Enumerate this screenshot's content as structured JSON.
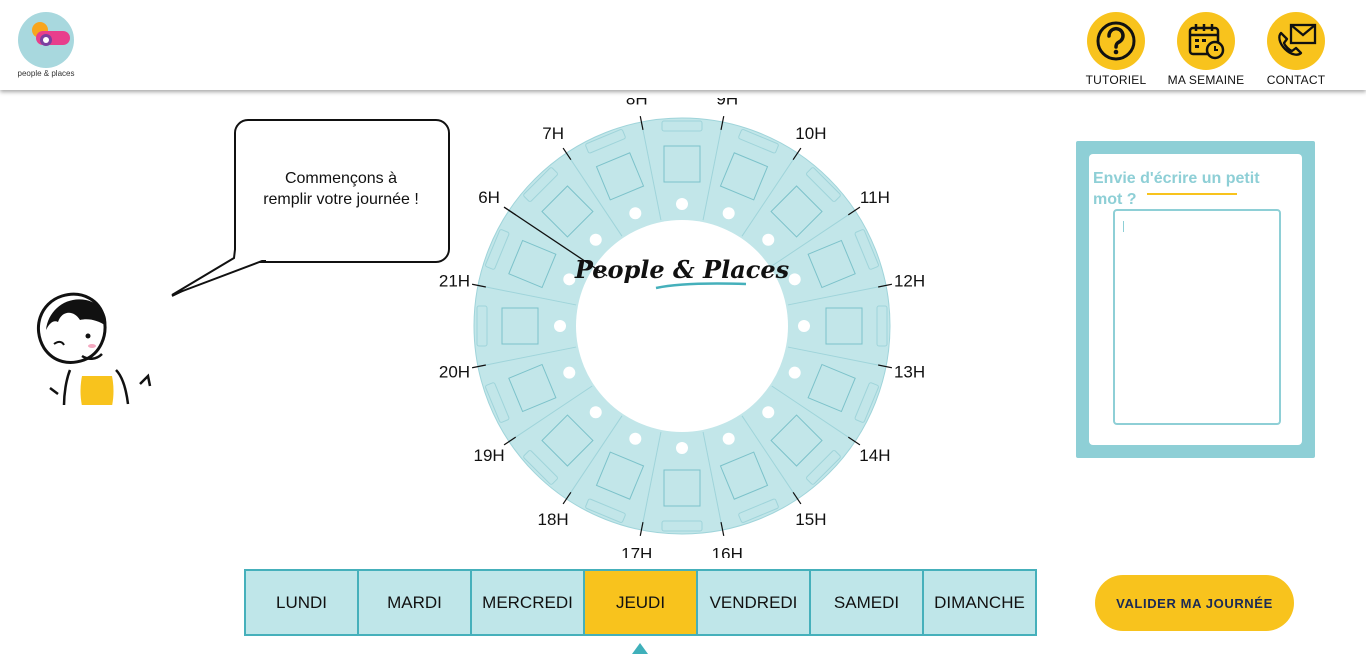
{
  "brand": {
    "name": "people & places",
    "wheel_logo": "People & Places"
  },
  "nav": [
    {
      "id": "tutoriel",
      "label": "TUTORIEL",
      "icon": "question-icon"
    },
    {
      "id": "ma-semaine",
      "label": "MA SEMAINE",
      "icon": "calendar-clock-icon"
    },
    {
      "id": "contact",
      "label": "CONTACT",
      "icon": "mail-phone-icon"
    }
  ],
  "speech_bubble": {
    "text_line1": "Commençons à",
    "text_line2": "remplir votre journée !"
  },
  "wheel": {
    "hours": [
      "8H",
      "9H",
      "10H",
      "11H",
      "12H",
      "13H",
      "14H",
      "15H",
      "16H",
      "17H",
      "18H",
      "19H",
      "20H",
      "21H",
      "6H",
      "7H"
    ],
    "slots": 16
  },
  "note": {
    "title": "Envie d'écrire un petit mot ?",
    "placeholder": ""
  },
  "days": {
    "items": [
      "LUNDI",
      "MARDI",
      "MERCREDI",
      "JEUDI",
      "VENDREDI",
      "SAMEDI",
      "DIMANCHE"
    ],
    "selected": "JEUDI"
  },
  "validate_label": "VALIDER MA JOURNÉE",
  "colors": {
    "accent": "#f8c31d",
    "teal": "#8ecfd6",
    "light_teal": "#bfe6e9",
    "dark_teal": "#45b0bb"
  }
}
